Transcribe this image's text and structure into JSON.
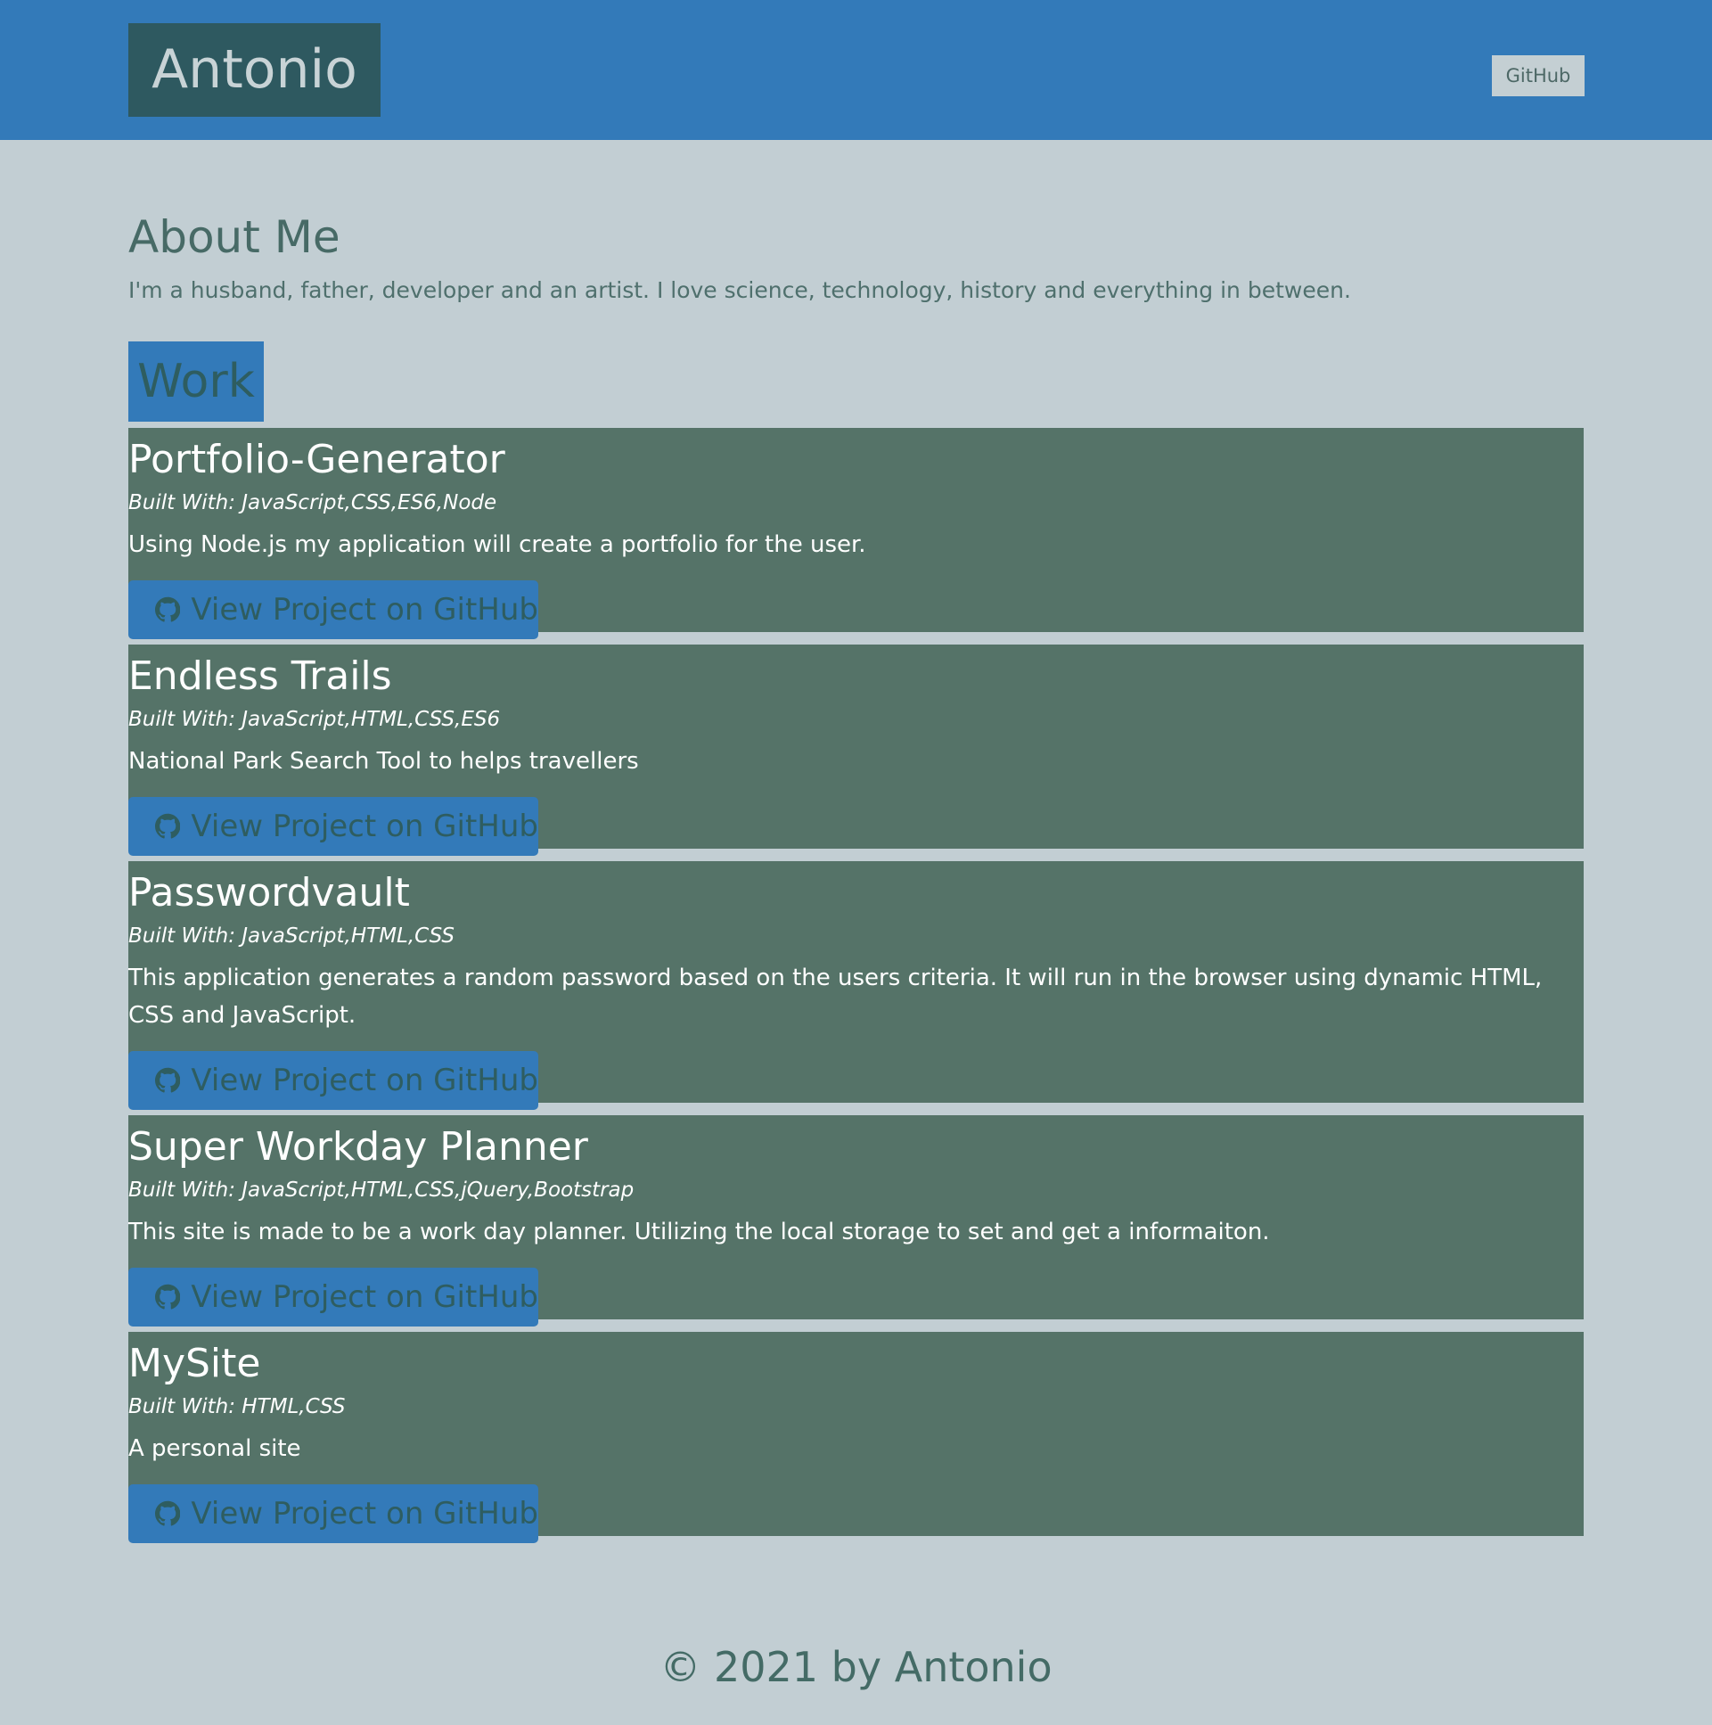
{
  "header": {
    "brand": "Antonio",
    "nav_link": "GitHub"
  },
  "about": {
    "title": "About Me",
    "text": "I'm a husband, father, developer and an artist. I love science, technology, history and everything in between."
  },
  "work": {
    "title": "Work",
    "button_label": "View Project on GitHub",
    "projects": [
      {
        "title": "Portfolio-Generator",
        "built_with": "Built With: JavaScript,CSS,ES6,Node",
        "description": "Using Node.js my application will create a portfolio for the user."
      },
      {
        "title": "Endless Trails",
        "built_with": "Built With: JavaScript,HTML,CSS,ES6",
        "description": "National Park Search Tool to helps travellers"
      },
      {
        "title": "Passwordvault",
        "built_with": "Built With: JavaScript,HTML,CSS",
        "description": "This application generates a random password based on the users criteria. It will run in the browser using dynamic HTML, CSS and JavaScript."
      },
      {
        "title": "Super Workday Planner",
        "built_with": "Built With: JavaScript,HTML,CSS,jQuery,Bootstrap",
        "description": "This site is made to be a work day planner. Utilizing the local storage to set and get a informaiton."
      },
      {
        "title": "MySite",
        "built_with": "Built With: HTML,CSS",
        "description": "A personal site"
      }
    ]
  },
  "footer": {
    "text": "© 2021 by Antonio"
  },
  "colors": {
    "header_bg": "#337ab9",
    "page_bg": "#c2ced3",
    "card_bg": "#557368",
    "brand_bg": "#2e5960"
  }
}
